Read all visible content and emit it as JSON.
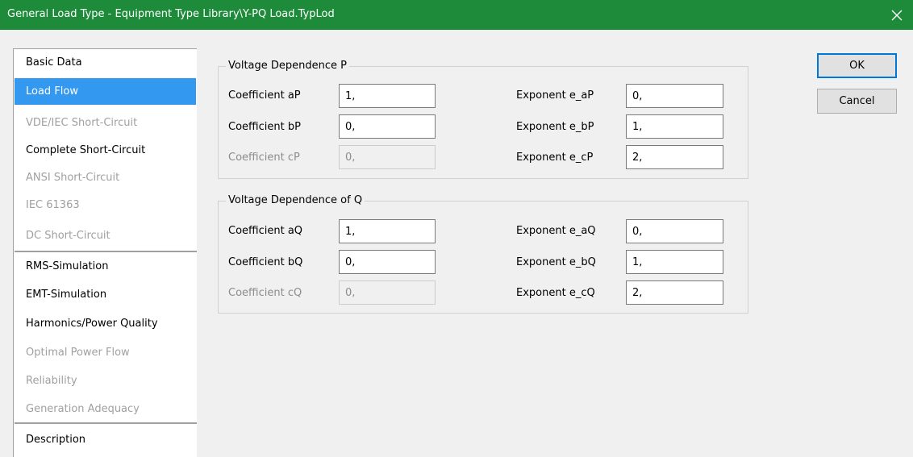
{
  "window": {
    "title": "General Load Type - Equipment Type Library\\Y-PQ Load.TypLod"
  },
  "nav": {
    "items": [
      {
        "label": "Basic Data",
        "state": "normal"
      },
      {
        "label": "Load Flow",
        "state": "selected"
      },
      {
        "label": "VDE/IEC Short-Circuit",
        "state": "disabled"
      },
      {
        "label": "Complete Short-Circuit",
        "state": "normal"
      },
      {
        "label": "ANSI Short-Circuit",
        "state": "disabled"
      },
      {
        "label": "IEC 61363",
        "state": "disabled"
      },
      {
        "label": "DC Short-Circuit",
        "state": "disabled"
      },
      {
        "label": "RMS-Simulation",
        "state": "normal"
      },
      {
        "label": "EMT-Simulation",
        "state": "normal"
      },
      {
        "label": "Harmonics/Power Quality",
        "state": "normal"
      },
      {
        "label": "Optimal Power Flow",
        "state": "disabled"
      },
      {
        "label": "Reliability",
        "state": "disabled"
      },
      {
        "label": "Generation Adequacy",
        "state": "disabled"
      },
      {
        "label": "Description",
        "state": "normal"
      }
    ]
  },
  "groupP": {
    "title": "Voltage Dependence P",
    "rows": [
      {
        "coef_label": "Coefficient aP",
        "coef_value": "1,",
        "coef_disabled": false,
        "exp_label": "Exponent e_aP",
        "exp_value": "0,"
      },
      {
        "coef_label": "Coefficient bP",
        "coef_value": "0,",
        "coef_disabled": false,
        "exp_label": "Exponent e_bP",
        "exp_value": "1,"
      },
      {
        "coef_label": "Coefficient cP",
        "coef_value": "0,",
        "coef_disabled": true,
        "exp_label": "Exponent e_cP",
        "exp_value": "2,"
      }
    ]
  },
  "groupQ": {
    "title": "Voltage Dependence of Q",
    "rows": [
      {
        "coef_label": "Coefficient aQ",
        "coef_value": "1,",
        "coef_disabled": false,
        "exp_label": "Exponent e_aQ",
        "exp_value": "0,"
      },
      {
        "coef_label": "Coefficient bQ",
        "coef_value": "0,",
        "coef_disabled": false,
        "exp_label": "Exponent e_bQ",
        "exp_value": "1,"
      },
      {
        "coef_label": "Coefficient cQ",
        "coef_value": "0,",
        "coef_disabled": true,
        "exp_label": "Exponent e_cQ",
        "exp_value": "2,"
      }
    ]
  },
  "buttons": {
    "ok": "OK",
    "cancel": "Cancel"
  },
  "icons": {
    "close": "close-icon"
  },
  "colors": {
    "titlebar": "#1e8b3a",
    "selection": "#3399f0",
    "default_button_border": "#0078d7"
  }
}
